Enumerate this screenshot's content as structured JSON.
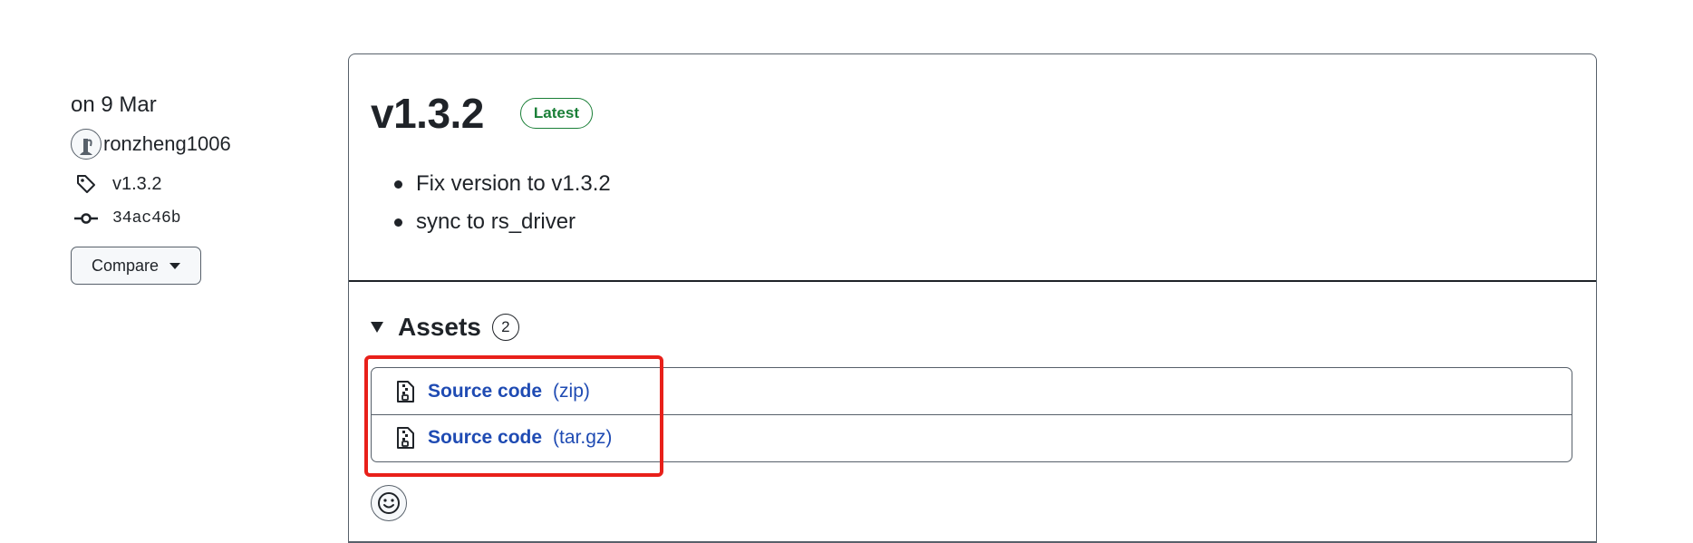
{
  "sidebar": {
    "date": "on 9 Mar",
    "author": "ronzheng1006",
    "tag": "v1.3.2",
    "commit": "34ac46b",
    "compare_label": "Compare"
  },
  "release": {
    "title": "v1.3.2",
    "badge": "Latest",
    "notes": [
      "Fix version to v1.3.2",
      "sync to rs_driver"
    ]
  },
  "assets": {
    "title": "Assets",
    "count": "2",
    "items": [
      {
        "name": "Source code",
        "ext": "(zip)"
      },
      {
        "name": "Source code",
        "ext": "(tar.gz)"
      }
    ]
  },
  "colors": {
    "latest_badge": "#1a7f37",
    "link": "#1f4bb3",
    "annotation_highlight": "#e8201a"
  },
  "icons": {
    "tag": "tag-icon",
    "commit": "git-commit-icon",
    "file_zip": "file-zip-icon",
    "reaction": "smiley-icon"
  }
}
